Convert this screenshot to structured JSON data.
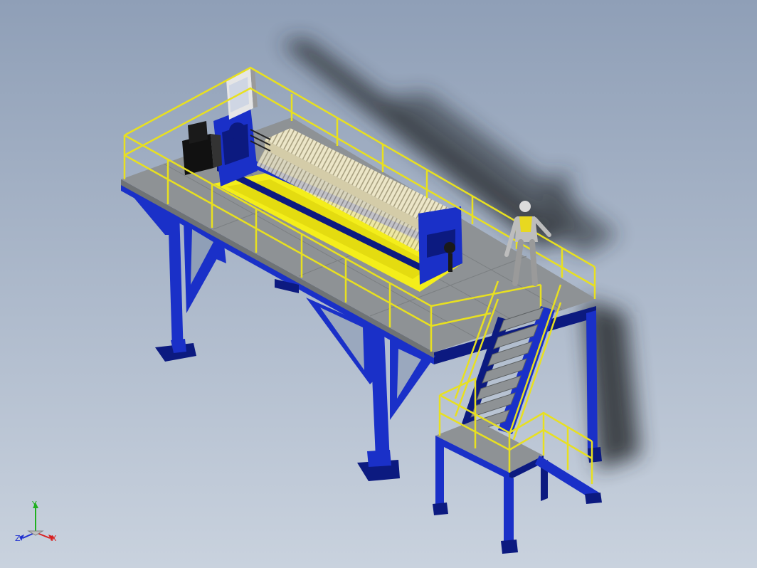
{
  "viewport": {
    "background_top": "#8f9fb7",
    "background_bottom": "#c9d2de"
  },
  "colors": {
    "structure_blue": "#1a30c8",
    "structure_blue_dark": "#0c1a80",
    "railing_yellow": "#e8e020",
    "deck_gray": "#8e9295",
    "deck_gray_dark": "#6f7375",
    "tray_yellow": "#f4ee1a",
    "plates_cream": "#ece6c8",
    "shadow": "#2a2d33"
  },
  "triad": {
    "x_label": "X",
    "y_label": "Y",
    "z_label": "Z",
    "x_color": "#d82020",
    "y_color": "#20b020",
    "z_color": "#2030d0"
  }
}
